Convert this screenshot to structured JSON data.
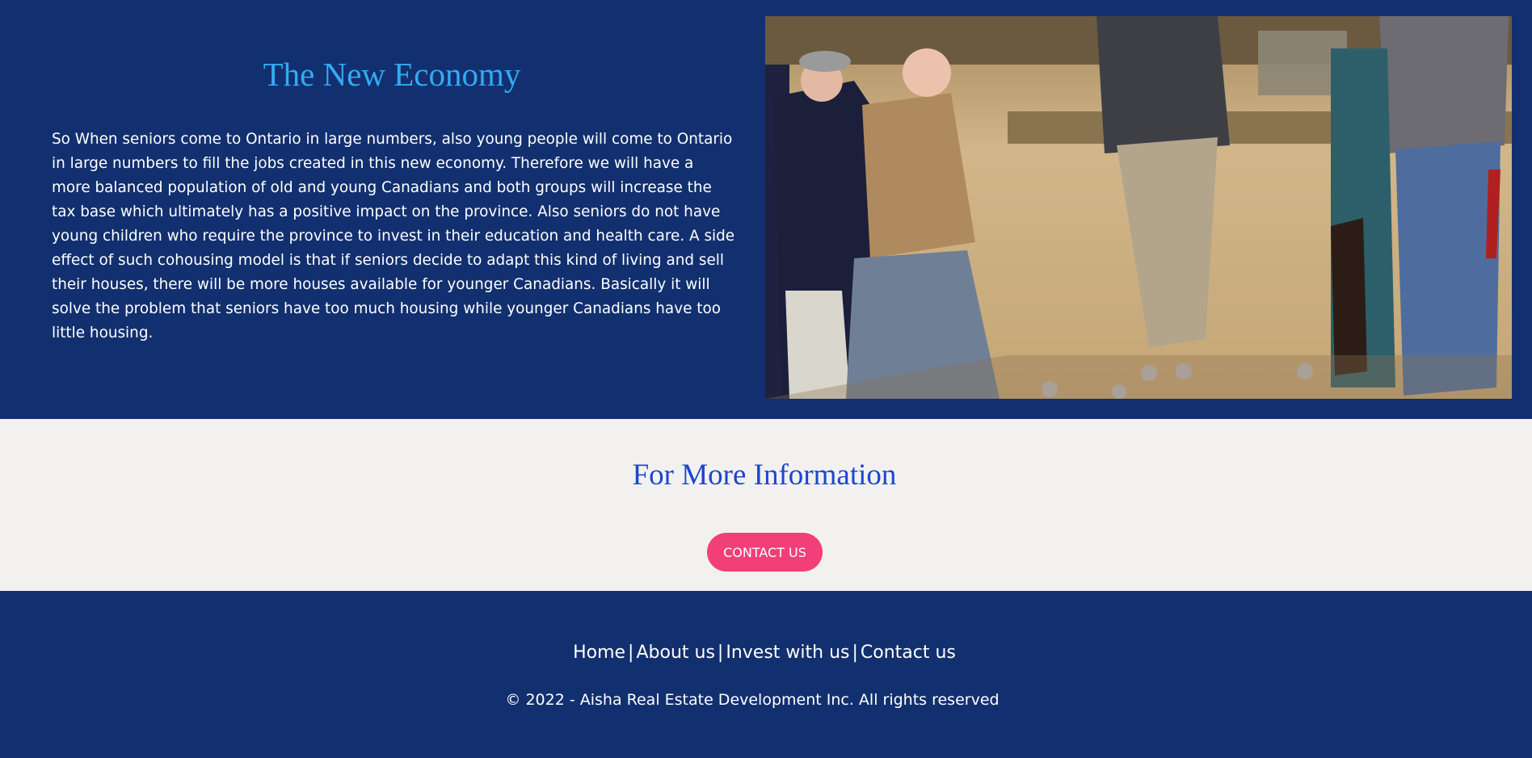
{
  "hero": {
    "title": "The New Economy",
    "body": "So When seniors come to Ontario in large numbers, also young people will come to Ontario in large numbers to fill the jobs created in this new economy. Therefore we will have a more balanced population of old and young Canadians and both groups will increase the tax base which ultimately has a positive impact on the province. Also seniors do not have young children who require the province to invest in their education and health care. A side effect of such cohousing model is that if seniors decide to adapt this kind of living and sell their houses, there will be more houses available for younger Canadians. Basically it will solve the problem that seniors have too much housing while younger Canadians have too little housing."
  },
  "info": {
    "title": "For More Information",
    "contact_button": "CONTACT US"
  },
  "footer": {
    "links": [
      "Home",
      "About us",
      "Invest with us",
      "Contact us"
    ],
    "separator": "|",
    "copyright": "© 2022 - Aisha Real Estate Development Inc. All rights reserved"
  },
  "colors": {
    "navy": "#12306f",
    "light_blue": "#33aaf2",
    "royal_blue": "#1c47cc",
    "pink": "#f23f79",
    "off_white": "#f3f1f0"
  }
}
